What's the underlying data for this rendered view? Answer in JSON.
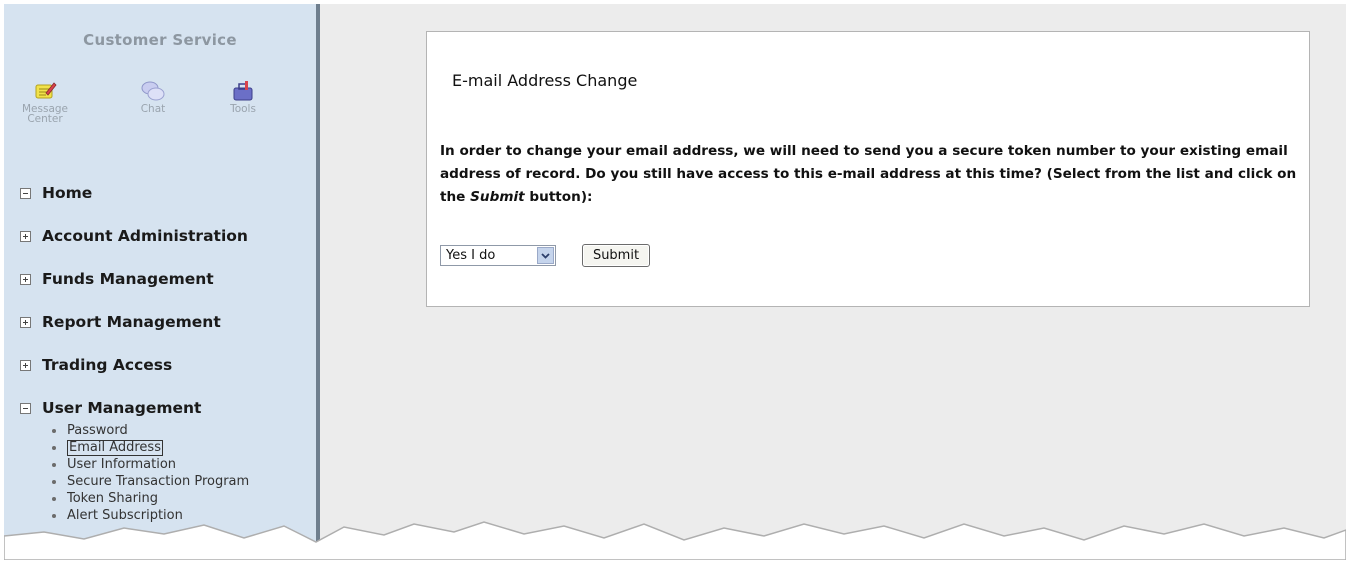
{
  "sidebar": {
    "title": "Customer Service",
    "tools": [
      {
        "label_line1": "Message",
        "label_line2": "Center",
        "icon": "message-center-icon"
      },
      {
        "label_line1": "Chat",
        "label_line2": "",
        "icon": "chat-icon"
      },
      {
        "label_line1": "Tools",
        "label_line2": "",
        "icon": "tools-icon"
      }
    ],
    "nav": [
      {
        "label": "Home",
        "state": "expanded"
      },
      {
        "label": "Account Administration",
        "state": "collapsed"
      },
      {
        "label": "Funds Management",
        "state": "collapsed"
      },
      {
        "label": "Report Management",
        "state": "collapsed"
      },
      {
        "label": "Trading Access",
        "state": "collapsed"
      },
      {
        "label": "User Management",
        "state": "expanded"
      }
    ],
    "user_management_items": [
      {
        "label": "Password"
      },
      {
        "label": "Email Address",
        "active": true
      },
      {
        "label": "User Information"
      },
      {
        "label": "Secure Transaction Program"
      },
      {
        "label": "Token Sharing"
      },
      {
        "label": "Alert Subscription"
      }
    ]
  },
  "main": {
    "title": "E-mail Address Change",
    "instructions_prefix": "In order to change your email address, we will need to send you a secure token number to your existing email address of record. Do you still have access to this e-mail address at this time? (Select from the list and click on the ",
    "instructions_emphasis": "Submit",
    "instructions_suffix": " button):",
    "access_select_value": "Yes I do",
    "submit_label": "Submit"
  },
  "colors": {
    "sidebar_bg": "#d6e3f0",
    "main_bg": "#ececec",
    "panel_bg": "#ffffff"
  }
}
